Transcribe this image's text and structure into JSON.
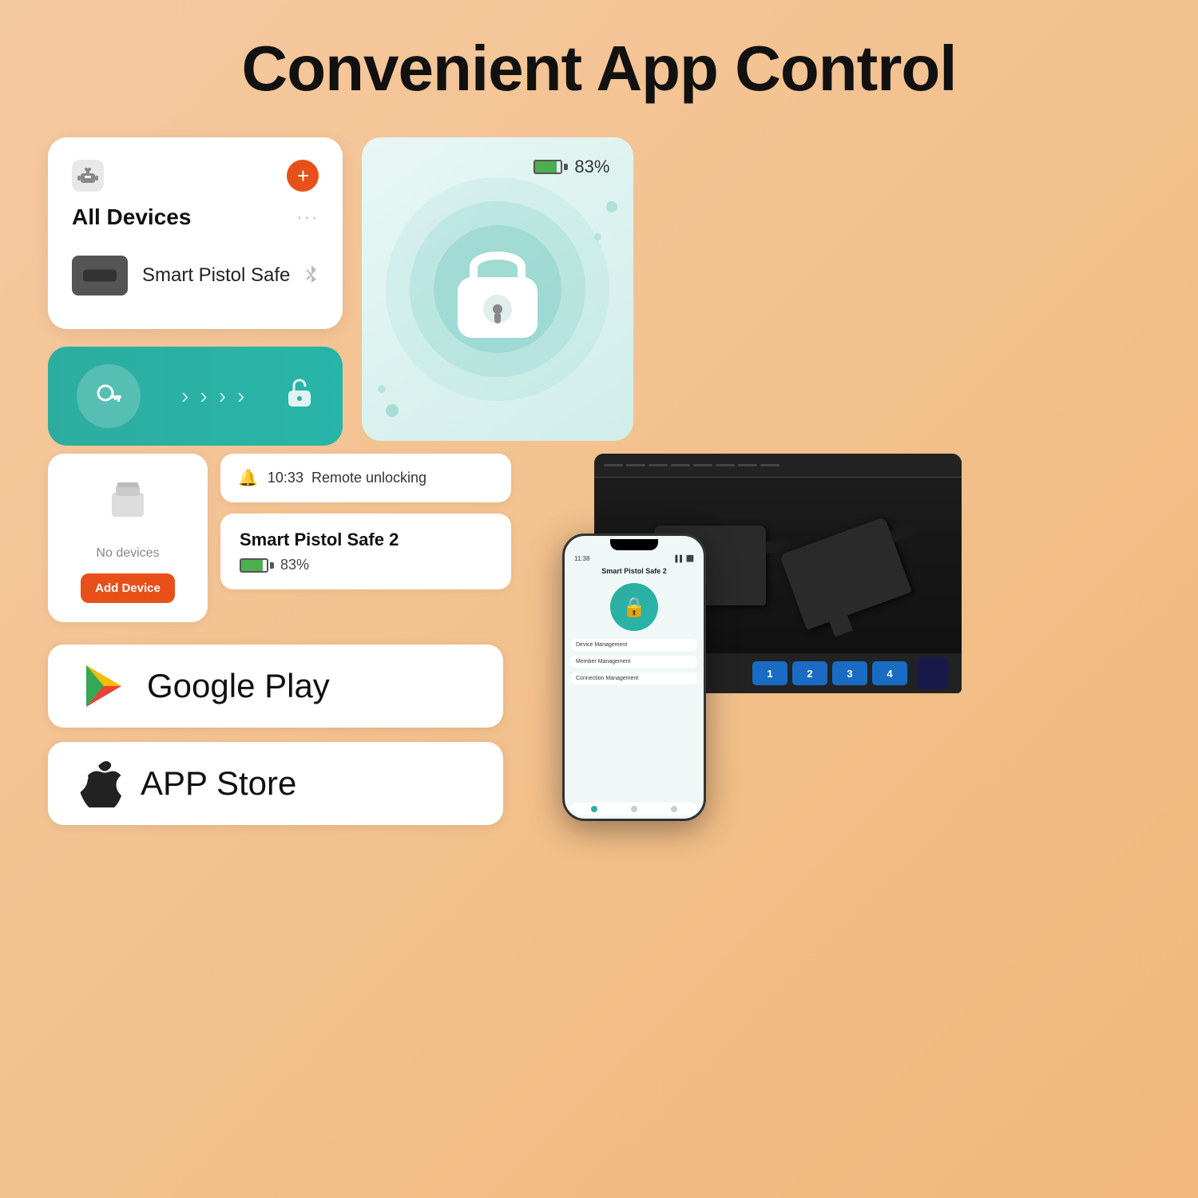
{
  "title": "Convenient App Control",
  "allDevices": {
    "label": "All Devices",
    "device": {
      "name": "Smart Pistol Safe"
    }
  },
  "unlockBar": {
    "arrows": [
      "›",
      "›",
      "›",
      "›"
    ]
  },
  "lockCard": {
    "batteryPercent": "83%"
  },
  "noDevices": {
    "text": "No devices",
    "addBtn": "Add Device"
  },
  "notification": {
    "time": "10:33",
    "action": "Remote unlocking"
  },
  "safe2": {
    "name": "Smart Pistol Safe 2",
    "battery": "83%"
  },
  "googlePlay": {
    "label": "Google Play"
  },
  "appStore": {
    "label": "APP Store"
  },
  "phone": {
    "statusTime": "11:38",
    "appTitle": "Smart Pistol Safe 2"
  },
  "keypad": [
    "1",
    "2",
    "3",
    "4"
  ]
}
